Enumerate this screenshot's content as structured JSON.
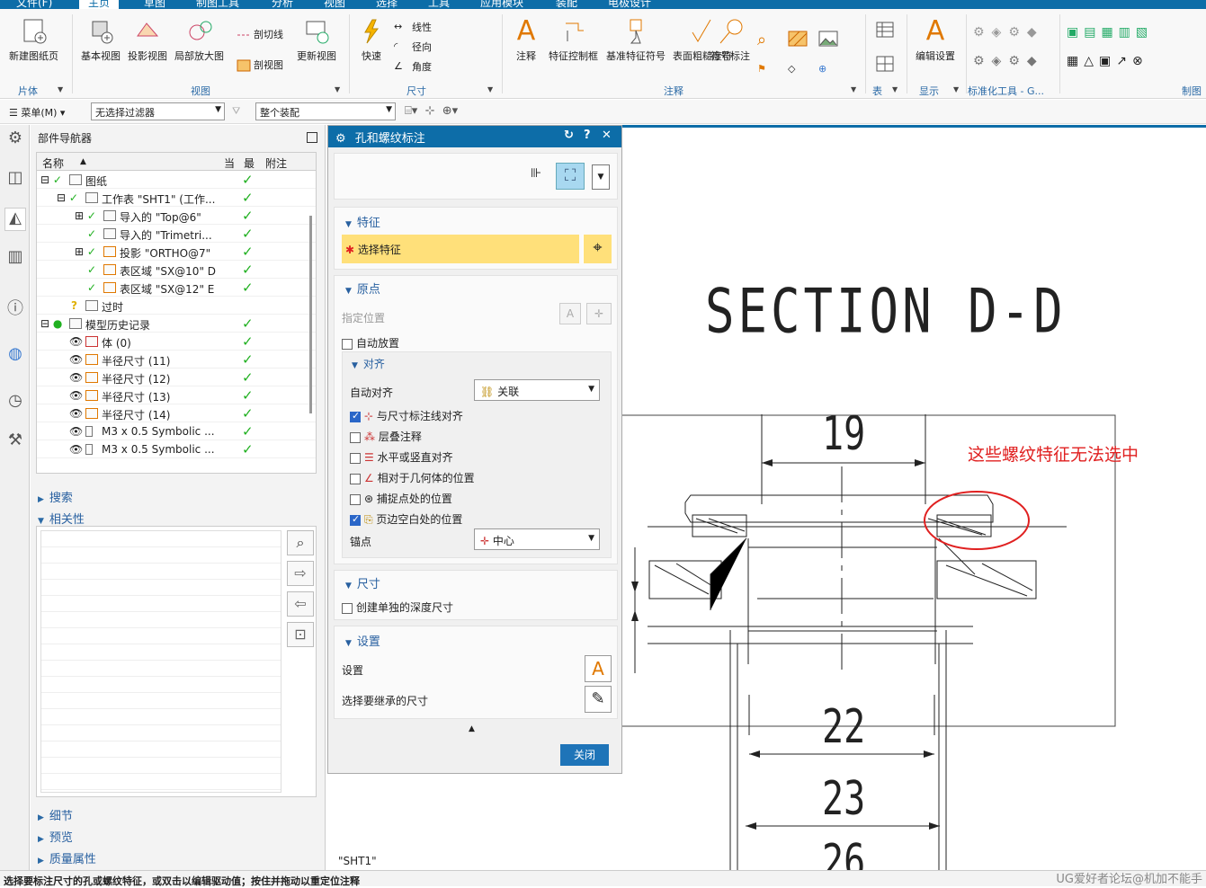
{
  "menu": {
    "tabs": [
      "文件(F)",
      "主页",
      "草图",
      "制图工具",
      "分析",
      "视图",
      "选择",
      "工具",
      "应用模块",
      "装配",
      "电极设计"
    ],
    "active": "主页"
  },
  "ribbon": {
    "new_sheet": "新建图纸页",
    "group_sheet": "片体",
    "base_view": "基本视图",
    "proj_view": "投影视图",
    "detail_view": "局部放大图",
    "section_line": "剖切线",
    "section_view": "剖视图",
    "update_view": "更新视图",
    "group_view": "视图",
    "quick": "快速",
    "linear": "线性",
    "radial": "径向",
    "angular": "角度",
    "group_dim": "尺寸",
    "note": "注释",
    "fcf": "特征控制框",
    "datum": "基准特征符号",
    "surface": "表面粗糙度符",
    "symbol": "符号标注",
    "group_annot": "注释",
    "group_table": "表",
    "edit_settings": "编辑设置",
    "group_display": "显示",
    "group_std": "标准化工具 - G...",
    "group_sketch": "制图"
  },
  "toolbar": {
    "menu": "菜单(M)",
    "filter": "无选择过滤器",
    "assembly": "整个装配"
  },
  "navigator": {
    "title": "部件导航器",
    "columns": [
      "名称",
      "当",
      "最",
      "附注"
    ],
    "rows": [
      {
        "label": "图纸",
        "check": true
      },
      {
        "label": "工作表 \"SHT1\" (工作...",
        "check": true
      },
      {
        "label": "导入的 \"Top@6\"",
        "check": true
      },
      {
        "label": "导入的 \"Trimetri...",
        "check": true
      },
      {
        "label": "投影 \"ORTHO@7\"",
        "check": true
      },
      {
        "label": "表区域 \"SX@10\" D",
        "check": true
      },
      {
        "label": "表区域 \"SX@12\" E",
        "check": true
      },
      {
        "label": "过时",
        "check": false
      },
      {
        "label": "模型历史记录",
        "check": true
      },
      {
        "label": "体 (0)",
        "check": true
      },
      {
        "label": "半径尺寸 (11)",
        "check": true
      },
      {
        "label": "半径尺寸 (12)",
        "check": true
      },
      {
        "label": "半径尺寸 (13)",
        "check": true
      },
      {
        "label": "半径尺寸 (14)",
        "check": true
      },
      {
        "label": "M3 x 0.5 Symbolic ...",
        "check": true
      },
      {
        "label": "M3 x 0.5 Symbolic ...",
        "check": true
      }
    ],
    "search": "搜索",
    "dependency": "相关性",
    "details": "细节",
    "preview": "预览",
    "mass": "质量属性"
  },
  "dialog": {
    "title": "孔和螺纹标注",
    "feature_section": "特征",
    "select_feature": "选择特征",
    "origin_section": "原点",
    "specify_location": "指定位置",
    "auto_place": "自动放置",
    "align_section": "对齐",
    "auto_align_label": "自动对齐",
    "auto_align_value": "关联",
    "align_dim_line": "与尺寸标注线对齐",
    "stack_note": "层叠注释",
    "hv_align": "水平或竖直对齐",
    "rel_geom": "相对于几何体的位置",
    "snap_point": "捕捉点处的位置",
    "margin_pos": "页边空白处的位置",
    "anchor_label": "锚点",
    "anchor_value": "中心",
    "dim_section": "尺寸",
    "depth_dim": "创建单独的深度尺寸",
    "settings_section": "设置",
    "settings_label": "设置",
    "inherit_label": "选择要继承的尺寸",
    "close": "关闭"
  },
  "drawing": {
    "section_title": "SECTION D-D",
    "dim1": "19",
    "dim2": "22",
    "dim3": "23",
    "dim4": "26",
    "annotation": "这些螺纹特征无法选中",
    "sheet": "\"SHT1\""
  },
  "status": {
    "text": "选择要标注尺寸的孔或螺纹特征，或双击以编辑驱动值；按住并拖动以重定位注释",
    "watermark": "UG爱好者论坛@机加不能手"
  },
  "colors": {
    "accent": "#0d6da8",
    "highlight": "#ffe07a",
    "annot": "#e02020",
    "check": "#20b020"
  }
}
